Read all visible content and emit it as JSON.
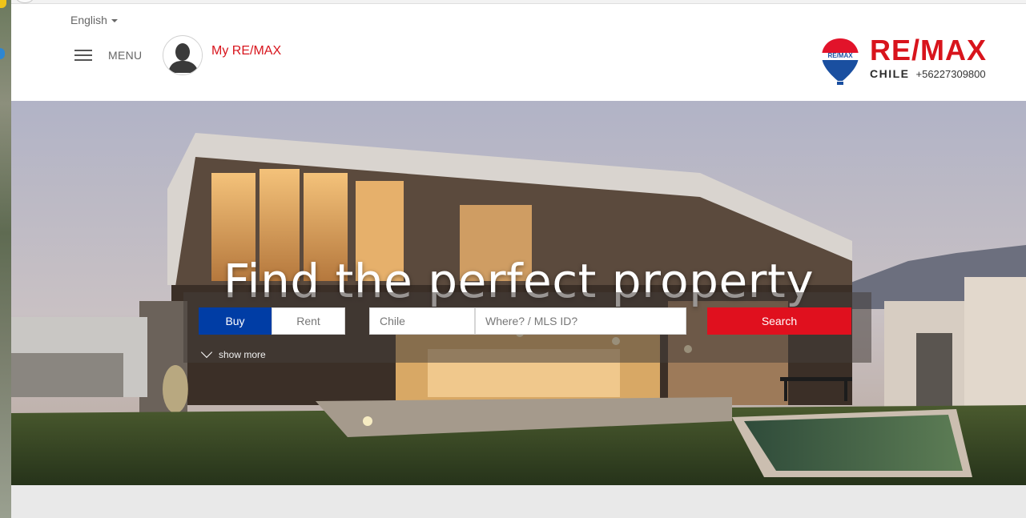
{
  "header": {
    "language": "English",
    "menu_label": "MENU",
    "account_label": "My RE/MAX",
    "logo": {
      "wordmark": "RE/MAX",
      "balloon_text": "RE/MAX",
      "country": "CHILE",
      "phone": "+56227309800"
    }
  },
  "hero": {
    "title": "Find the perfect property",
    "search": {
      "modes": [
        "Buy",
        "Rent"
      ],
      "active_mode": "Buy",
      "country_value": "Chile",
      "location_placeholder": "Where? / MLS ID?",
      "submit_label": "Search",
      "show_more_label": "show more"
    }
  },
  "colors": {
    "brand_red": "#d8141c",
    "search_red": "#e0101e",
    "buy_blue": "#003da5"
  }
}
